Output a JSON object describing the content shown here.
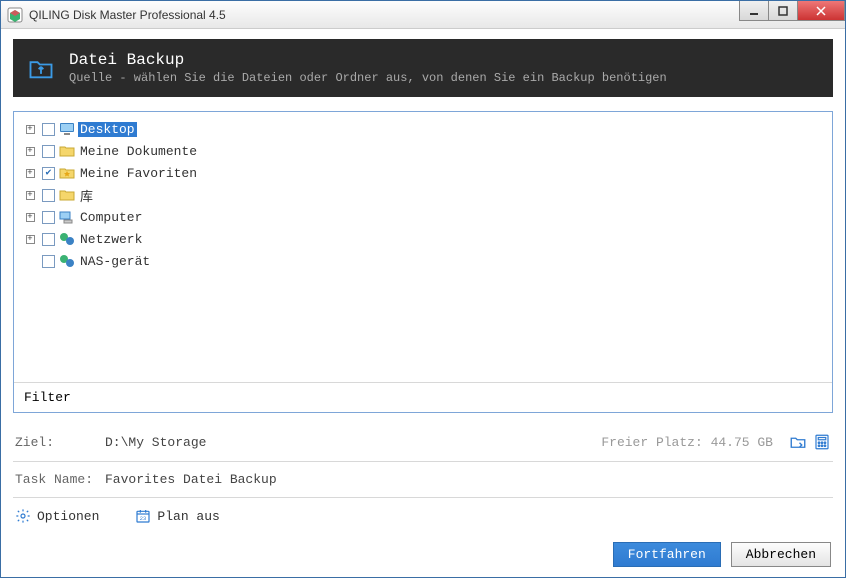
{
  "window": {
    "title": "QILING Disk Master Professional 4.5"
  },
  "header": {
    "title": "Datei Backup",
    "subtitle": "Quelle - wählen Sie die Dateien oder Ordner aus, von denen Sie ein Backup benötigen"
  },
  "tree": {
    "items": [
      {
        "label": "Desktop",
        "icon": "monitor",
        "expandable": true,
        "checked": false,
        "selected": true
      },
      {
        "label": "Meine Dokumente",
        "icon": "folder",
        "expandable": true,
        "checked": false,
        "selected": false
      },
      {
        "label": "Meine Favoriten",
        "icon": "star-folder",
        "expandable": true,
        "checked": true,
        "selected": false
      },
      {
        "label": "库",
        "icon": "folder",
        "expandable": true,
        "checked": false,
        "selected": false
      },
      {
        "label": "Computer",
        "icon": "computer",
        "expandable": true,
        "checked": false,
        "selected": false
      },
      {
        "label": "Netzwerk",
        "icon": "network",
        "expandable": true,
        "checked": false,
        "selected": false
      },
      {
        "label": "NAS-gerät",
        "icon": "network",
        "expandable": false,
        "checked": false,
        "selected": false
      }
    ]
  },
  "filter": {
    "label": "Filter",
    "value": ""
  },
  "dest": {
    "label": "Ziel:",
    "path": "D:\\My Storage",
    "free_label": "Freier Platz:",
    "free_value": "44.75 GB"
  },
  "task": {
    "label": "Task Name:",
    "value": "Favorites Datei Backup"
  },
  "options": {
    "options_label": "Optionen",
    "schedule_label": "Plan aus"
  },
  "buttons": {
    "proceed": "Fortfahren",
    "cancel": "Abbrechen"
  }
}
